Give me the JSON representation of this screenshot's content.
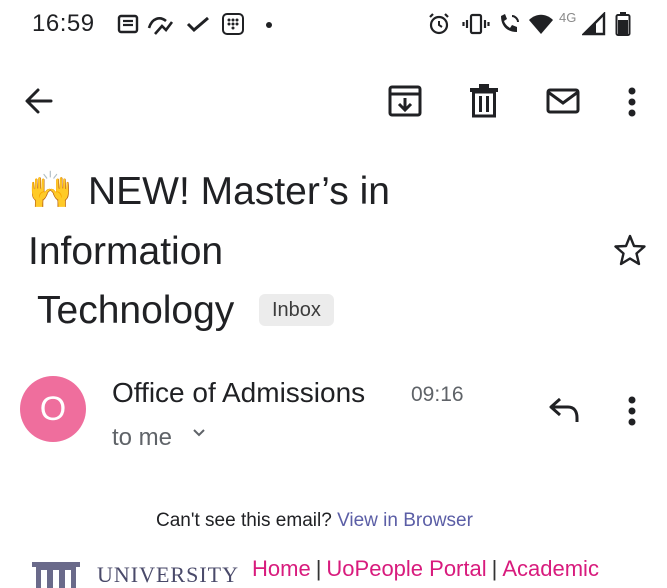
{
  "status_bar": {
    "time": "16:59",
    "network": "4G"
  },
  "toolbar": {
    "back": "back-arrow-icon",
    "archive": "archive-icon",
    "delete": "trash-icon",
    "mark_unread": "mail-icon",
    "more": "more-vert-icon"
  },
  "email": {
    "subject_emoji": "🙌",
    "subject_line1": "NEW! Master’s in",
    "subject_line2": "Information",
    "subject_line3": "Technology",
    "label": "Inbox",
    "sender_initial": "O",
    "sender_name": "Office of Admissions",
    "time": "09:16",
    "recipient": "to me"
  },
  "body": {
    "cant_see": "Can't see this email?",
    "view_in_browser": "View in Browser",
    "university": "UNIVERSITY",
    "nav_home": "Home",
    "nav_sep": "|",
    "nav_portal": "UoPeople Portal",
    "nav_academic": "Academic"
  },
  "colors": {
    "avatar": "#ef6e9d",
    "link_purple": "#5b5ea6",
    "nav_pink": "#d81b7d"
  }
}
